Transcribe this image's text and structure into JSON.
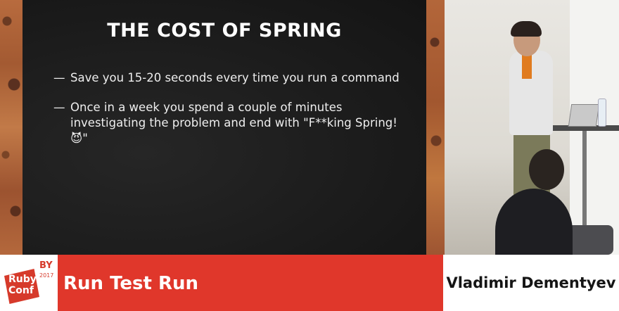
{
  "slide": {
    "title": "THE COST OF SPRING",
    "bullets": [
      "Save you 15-20 seconds every time you run a command",
      "Once in a week you spend a couple of minutes investigating the problem and end with \"F**king Spring! 😈\""
    ],
    "bullet_marker": "—"
  },
  "lower_third": {
    "logo": {
      "line1": "Ruby",
      "line2": "Conf",
      "badge": "BY",
      "year": "2017",
      "color": "#d63a2b"
    },
    "talk_title": "Run Test Run",
    "speaker_name": "Vladimir Dementyev",
    "accent_color": "#e0372b"
  }
}
